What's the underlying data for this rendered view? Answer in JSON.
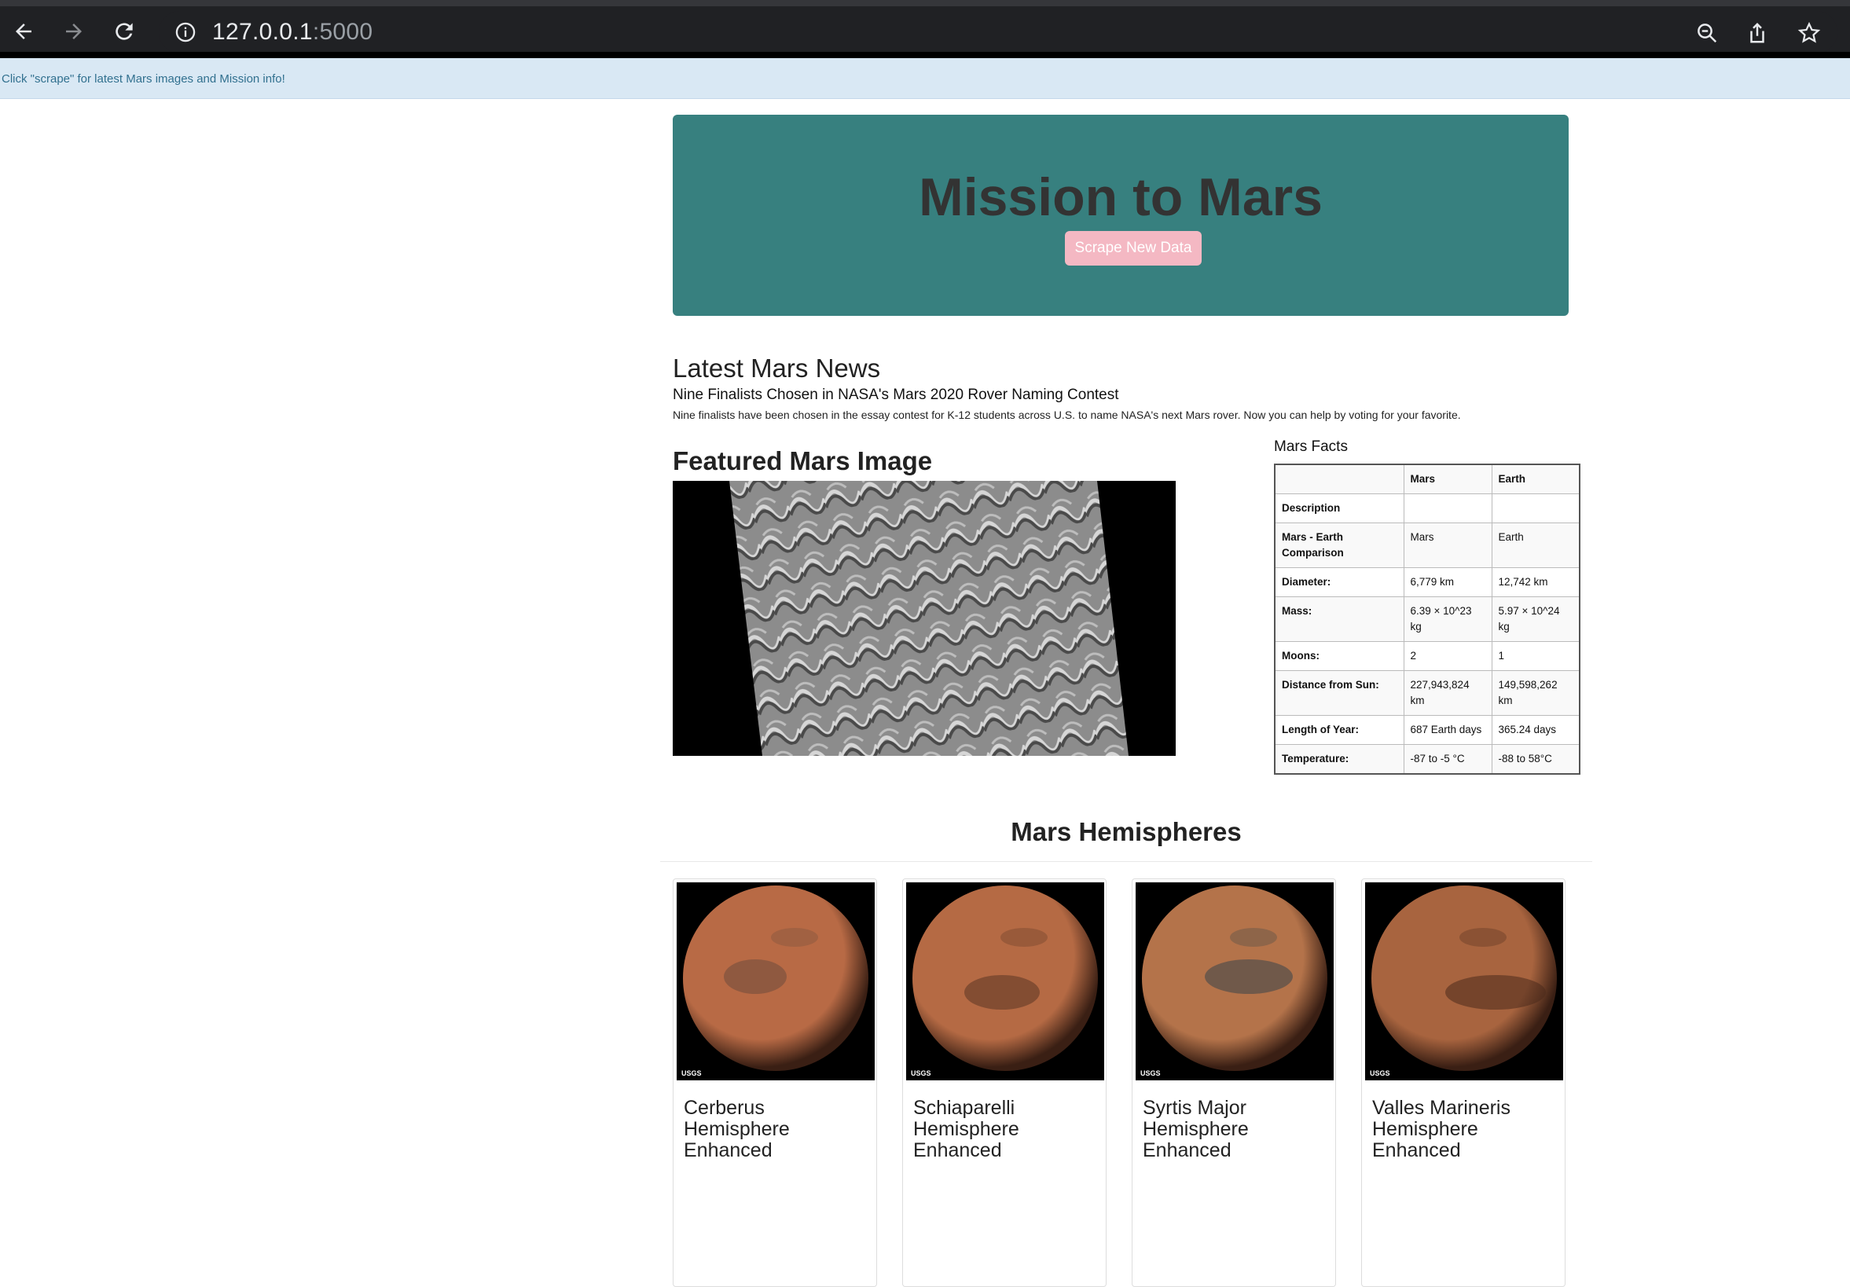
{
  "browser": {
    "url_host": "127.0.0.1",
    "url_port": ":5000"
  },
  "flash": {
    "message": "Click \"scrape\" for latest Mars images and Mission info!"
  },
  "jumbotron": {
    "title": "Mission to Mars",
    "button_label": "Scrape New Data"
  },
  "news": {
    "heading": "Latest Mars News",
    "title": "Nine Finalists Chosen in NASA's Mars 2020 Rover Naming Contest",
    "paragraph": "Nine finalists have been chosen in the essay contest for K-12 students across U.S. to name NASA's next Mars rover. Now you can help by voting for your favorite."
  },
  "featured": {
    "heading": "Featured Mars Image"
  },
  "facts": {
    "heading": "Mars Facts",
    "header": [
      "",
      "Mars",
      "Earth"
    ],
    "rows": [
      [
        "Description",
        "",
        ""
      ],
      [
        "Mars - Earth Comparison",
        "Mars",
        "Earth"
      ],
      [
        "Diameter:",
        "6,779 km",
        "12,742 km"
      ],
      [
        "Mass:",
        "6.39 × 10^23 kg",
        "5.97 × 10^24 kg"
      ],
      [
        "Moons:",
        "2",
        "1"
      ],
      [
        "Distance from Sun:",
        "227,943,824 km",
        "149,598,262 km"
      ],
      [
        "Length of Year:",
        "687 Earth days",
        "365.24 days"
      ],
      [
        "Temperature:",
        "-87 to -5 °C",
        "-88 to 58°C"
      ]
    ]
  },
  "hemispheres": {
    "heading": "Mars Hemisphere",
    "cards": [
      {
        "title": "Cerberus Hemisphere Enhanced",
        "base": "#b86a45",
        "dark": "#6e4b3d"
      },
      {
        "title": "Schiaparelli Hemisphere Enhanced",
        "base": "#b56a44",
        "dark": "#5a3424"
      },
      {
        "title": "Syrtis Major Hemisphere Enhanced",
        "base": "#b4734a",
        "dark": "#39444a"
      },
      {
        "title": "Valles Marineris Hemisphere Enhanced",
        "base": "#a8643f",
        "dark": "#4a2a1c"
      }
    ],
    "logo_text": "USGS"
  },
  "colors": {
    "jumbotron_bg": "#37807f",
    "button_bg": "#f4b8c3",
    "flash_bg": "#d9e8f4"
  }
}
